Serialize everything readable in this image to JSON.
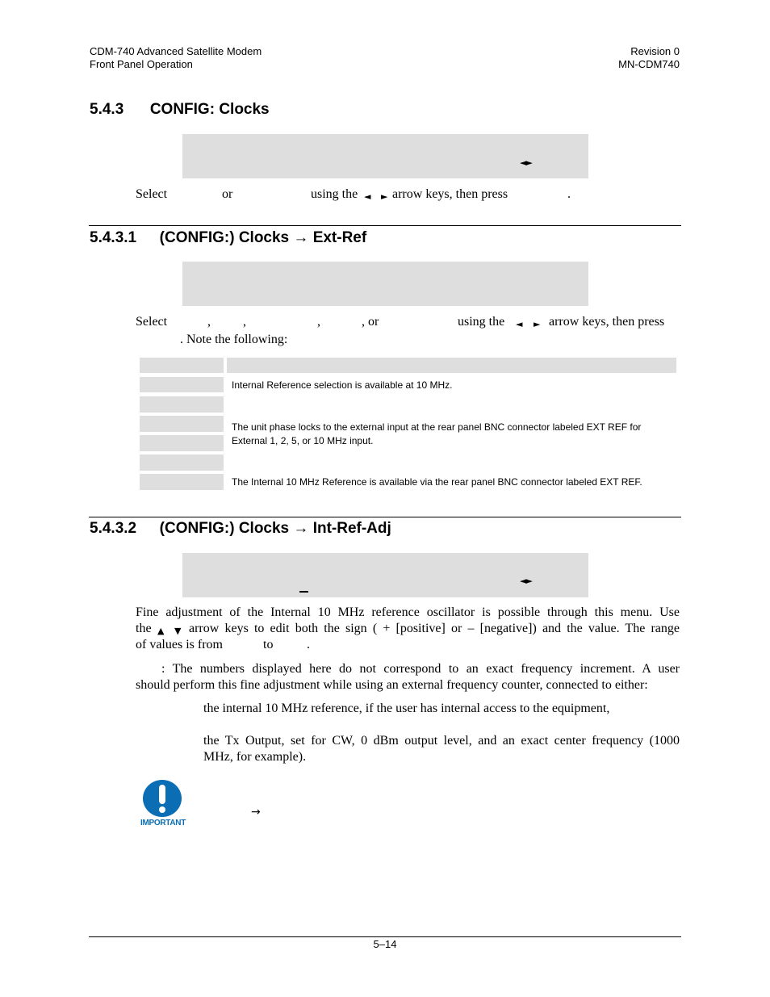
{
  "header": {
    "left_line1": "CDM-740 Advanced Satellite Modem",
    "left_line2": "Front Panel Operation",
    "right_line1": "Revision 0",
    "right_line2": "MN-CDM740"
  },
  "section_543": {
    "number": "5.4.3",
    "title": "CONFIG: Clocks",
    "lcd_arrows": "◄►",
    "instruction": {
      "select": "Select",
      "or": "or",
      "using": "using the",
      "left_arrow": "◄",
      "right_arrow": "►",
      "rest": "arrow keys, then press",
      "period": "."
    }
  },
  "section_5431": {
    "number": "5.4.3.1",
    "title": "(CONFIG:) Clocks",
    "arrow": "→",
    "subtitle": "Ext-Ref",
    "instruction": {
      "select": "Select",
      "comma1": ",",
      "comma2": ",",
      "comma3": ",",
      "or": ", or",
      "using": "using the",
      "left_arrow": "◄",
      "right_arrow": "►",
      "rest": "arrow keys, then press",
      "note": ". Note the following:"
    },
    "table": {
      "rows": [
        {
          "desc": ""
        },
        {
          "desc": "Internal Reference selection is available at 10 MHz."
        },
        {
          "desc": ""
        },
        {
          "desc": "The unit phase locks to the external input at the rear panel BNC connector labeled EXT REF for External 1, 2, 5, or 10 MHz input."
        },
        {
          "desc": ""
        },
        {
          "desc": "The Internal 10 MHz Reference  is available via the rear panel BNC connector labeled EXT REF."
        }
      ]
    }
  },
  "section_5432": {
    "number": "5.4.3.2",
    "title": "(CONFIG:) Clocks",
    "arrow": "→",
    "subtitle": "Int-Ref-Adj",
    "lcd_arrows": "◄►",
    "para1_line1": "Fine adjustment of the Internal 10 MHz reference oscillator is possible through this menu. Use",
    "para1_line2_a": "the",
    "para1_up": "▲",
    "para1_down": "▼",
    "para1_line2_b": "arrow keys to edit both the sign ( + [positive] or – [negative]) and the value. The range",
    "para1_line3_a": "of values is from",
    "para1_line3_to": "to",
    "para1_line3_end": ".",
    "para2_line1": ": The numbers displayed here do not correspond to an exact frequency increment. A user",
    "para2_line2": "should perform this fine adjustment while using an external frequency counter, connected to either:",
    "bullet1": "the internal 10 MHz reference, if the user has internal access to the equipment,",
    "bullet2_line1": "the Tx Output, set for CW, 0 dBm output level, and an exact center frequency (1000",
    "bullet2_line2": "MHz, for example).",
    "important_label": "IMPORTANT",
    "important_arrow": "→"
  },
  "footer": {
    "page_number": "5–14"
  }
}
